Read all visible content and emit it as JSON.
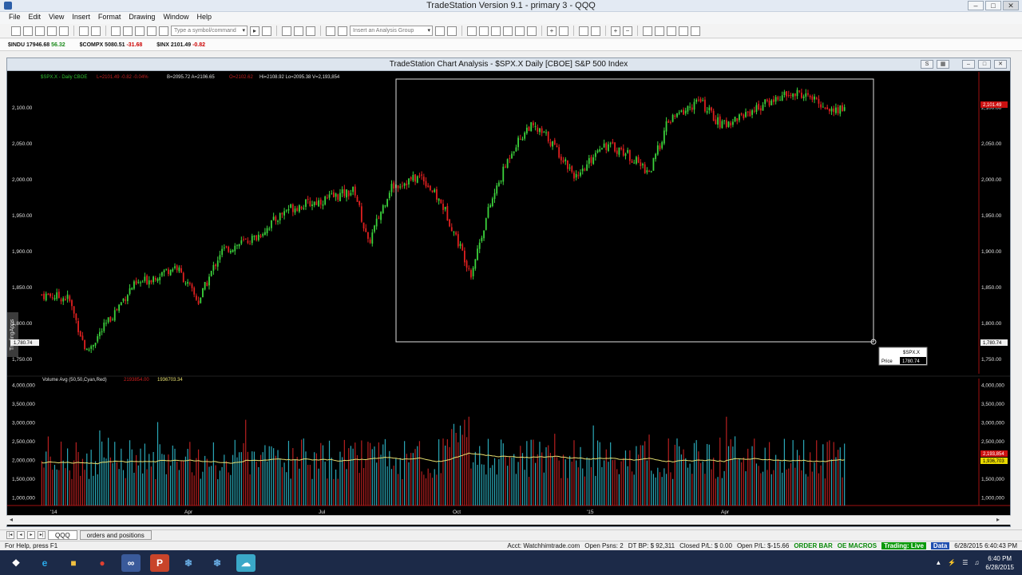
{
  "app": {
    "window_title": "TradeStation Version 9.1 - primary 3 - QQQ",
    "menu": [
      "File",
      "Edit",
      "View",
      "Insert",
      "Format",
      "Drawing",
      "Window",
      "Help"
    ]
  },
  "toolbar": {
    "symbol_placeholder": "Type a symbol/command",
    "analysis_group_placeholder": "Insert an Analysis Group"
  },
  "ticker_bar": [
    {
      "symbol": "$INDU",
      "last": "17946.68",
      "change": "56.32",
      "direction": "up"
    },
    {
      "symbol": "$COMPX",
      "last": "5080.51",
      "change": "-31.68",
      "direction": "down"
    },
    {
      "symbol": "$INX",
      "last": "2101.49",
      "change": "-0.82",
      "direction": "down"
    }
  ],
  "chart_window": {
    "title": "TradeStation Chart Analysis - $SPX.X Daily [CBOE] S&P 500 Index",
    "side_tab": "TradingApps",
    "legend": {
      "symbol": "$SPX.X - Daily  CBOE",
      "last_pct": "L=2101.49  -0.82  -0.04%",
      "bid_ask": "B=2095.72  A=2106.65",
      "open": "O=2102.62",
      "hlv": "Hi=2108.92  Lo=2095.38  V=2,193,854"
    },
    "volume_legend": {
      "label": "Volume Avg (50,50,Cyan,Red)",
      "vol_value": "2193854.00",
      "avg_value": "1936703.34"
    },
    "crosshair_price": "1,780.74",
    "tooltip": {
      "symbol": "$SPX.X",
      "label": "Price",
      "value": "1780.74"
    },
    "last_price_tag": "2,101.49",
    "volume_tag_red": "2,193,854",
    "volume_tag_yellow": "1,936,703"
  },
  "chart_data": [
    {
      "type": "candlestick",
      "name": "$SPX.X Daily",
      "ylim": [
        1730,
        2140
      ],
      "y_ticks": [
        1750,
        1800,
        1850,
        1900,
        1950,
        2000,
        2050,
        2100
      ],
      "y_tick_labels": [
        "1,750.00",
        "1,800.00",
        "1,850.00",
        "1,900.00",
        "1,950.00",
        "2,000.00",
        "2,050.00",
        "2,100.00"
      ],
      "x_tick_labels": [
        "'14",
        "Apr",
        "Jul",
        "Oct",
        "'15",
        "Apr"
      ],
      "x_tick_months": [
        0,
        3,
        6,
        9,
        12,
        15
      ],
      "trend": {
        "month": [
          0,
          0.6,
          1.0,
          1.4,
          2.0,
          3.0,
          3.5,
          4.0,
          4.8,
          5.5,
          6.2,
          7.0,
          7.3,
          7.8,
          8.5,
          9.0,
          9.6,
          10.0,
          10.5,
          10.9,
          11.3,
          12.0,
          12.5,
          13.0,
          13.6,
          14.0,
          14.7,
          15.2,
          16.0,
          16.5,
          17.0,
          17.7,
          18.0
        ],
        "close": [
          1840,
          1835,
          1760,
          1795,
          1850,
          1880,
          1830,
          1900,
          1920,
          1960,
          1970,
          1985,
          1910,
          1990,
          2005,
          1960,
          1870,
          1960,
          2040,
          2075,
          2060,
          2000,
          2050,
          2040,
          2010,
          2080,
          2110,
          2075,
          2100,
          2115,
          2120,
          2095,
          2101
        ]
      }
    },
    {
      "type": "bar",
      "name": "Volume",
      "ylim": [
        800000,
        4100000
      ],
      "y_ticks": [
        1000000,
        1500000,
        2000000,
        2500000,
        3000000,
        3500000,
        4000000
      ],
      "y_tick_labels": [
        "1,000,000",
        "1,500,000",
        "2,000,000",
        "2,500,000",
        "3,000,000",
        "3,500,000",
        "4,000,000"
      ],
      "volume_average_level": 2000000
    }
  ],
  "tabs": [
    "QQQ",
    "orders and positions"
  ],
  "status": {
    "help": "For Help, press F1",
    "account": "Acct: Watchhimtrade.com",
    "open_psns": "Open Psns: 2",
    "dt_bp": "DT BP: $ 92,311",
    "closed_pl": "Closed P/L: $ 0.00",
    "open_pl": "Open P/L: $-15.66",
    "order_bar": "ORDER BAR",
    "oe_macros": "OE MACROS",
    "trading": "Trading: Live",
    "data": "Data",
    "datetime": "6/28/2015 6:40:43 PM"
  },
  "taskbar": {
    "time": "6:40 PM",
    "date": "6/28/2015"
  },
  "colors": {
    "up_candle": "#3cd23c",
    "down_candle": "#e02020",
    "volume_up": "#2aa8b8",
    "volume_down": "#b82020",
    "volume_avg": "#e8e070",
    "tag_red": "#cc1010",
    "tag_yellow": "#e8d800"
  }
}
